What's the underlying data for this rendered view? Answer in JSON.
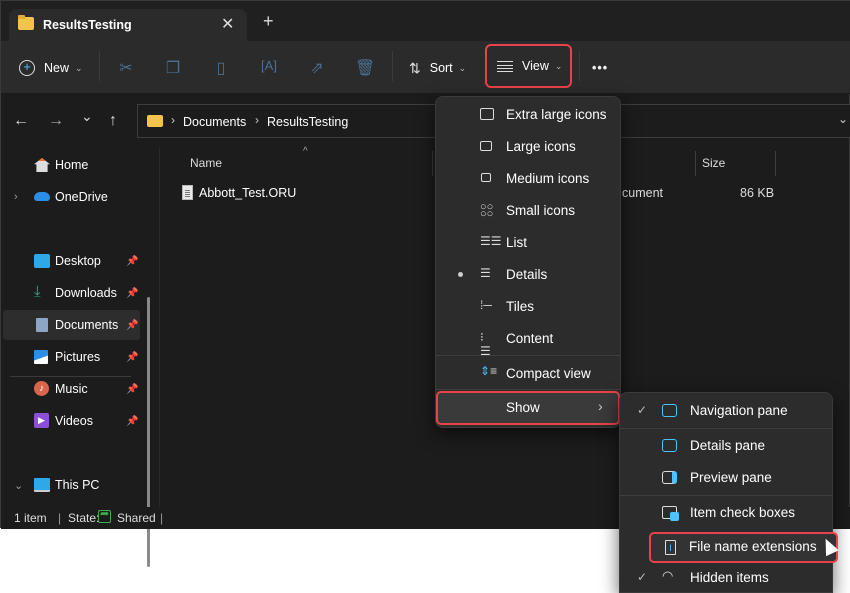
{
  "window": {
    "tab_title": "ResultsTesting",
    "close_icon": "close-icon",
    "newtab_icon": "plus-icon"
  },
  "toolbar": {
    "new_label": "New",
    "sort_label": "Sort",
    "view_label": "View",
    "more_label": "•••",
    "icons": [
      "cut-icon",
      "copy-icon",
      "paste-icon",
      "rename-icon",
      "share-icon",
      "delete-icon"
    ]
  },
  "nav": {
    "back": "←",
    "forward": "→",
    "recent": "⌄",
    "up": "↑"
  },
  "breadcrumb": [
    "Documents",
    "ResultsTesting"
  ],
  "sidebar": {
    "items": [
      {
        "label": "Home",
        "icon": "home-icon",
        "pinned": false
      },
      {
        "label": "OneDrive",
        "icon": "onedrive-icon",
        "pinned": false,
        "expandable": true
      },
      {
        "label": "Desktop",
        "icon": "desktop-icon",
        "pinned": true
      },
      {
        "label": "Downloads",
        "icon": "downloads-icon",
        "pinned": true
      },
      {
        "label": "Documents",
        "icon": "documents-icon",
        "pinned": true,
        "selected": true
      },
      {
        "label": "Pictures",
        "icon": "pictures-icon",
        "pinned": true
      },
      {
        "label": "Music",
        "icon": "music-icon",
        "pinned": true
      },
      {
        "label": "Videos",
        "icon": "videos-icon",
        "pinned": true
      },
      {
        "label": "This PC",
        "icon": "this-pc-icon",
        "pinned": false,
        "expanded": true
      }
    ]
  },
  "content": {
    "columns": [
      "Name",
      "Size"
    ],
    "files": [
      {
        "name": "Abbott_Test.ORU",
        "type_partial": "cument",
        "size": "86 KB"
      }
    ]
  },
  "status": {
    "count": "1 item",
    "state_label": "State:",
    "state_value": "Shared"
  },
  "view_menu": {
    "items": [
      {
        "label": "Extra large icons",
        "icon": "extra-large-icons-icon"
      },
      {
        "label": "Large icons",
        "icon": "large-icons-icon"
      },
      {
        "label": "Medium icons",
        "icon": "medium-icons-icon"
      },
      {
        "label": "Small icons",
        "icon": "small-icons-icon"
      },
      {
        "label": "List",
        "icon": "list-icon"
      },
      {
        "label": "Details",
        "icon": "details-icon",
        "selected": true
      },
      {
        "label": "Tiles",
        "icon": "tiles-icon"
      },
      {
        "label": "Content",
        "icon": "content-icon"
      },
      {
        "label": "Compact view",
        "icon": "compact-view-icon"
      },
      {
        "label": "Show",
        "icon": "chevron-right-icon",
        "submenu": true
      }
    ]
  },
  "show_menu": {
    "items": [
      {
        "label": "Navigation pane",
        "checked": true,
        "icon": "navigation-pane-icon"
      },
      {
        "label": "Details pane",
        "checked": false,
        "icon": "details-pane-icon"
      },
      {
        "label": "Preview pane",
        "checked": false,
        "icon": "preview-pane-icon"
      },
      {
        "label": "Item check boxes",
        "checked": false,
        "icon": "item-check-boxes-icon"
      },
      {
        "label": "File name extensions",
        "checked": false,
        "icon": "file-name-extensions-icon"
      },
      {
        "label": "Hidden items",
        "checked": true,
        "icon": "hidden-items-icon"
      }
    ]
  },
  "colors": {
    "highlight": "#e8424a",
    "accent": "#4cc2ff"
  }
}
